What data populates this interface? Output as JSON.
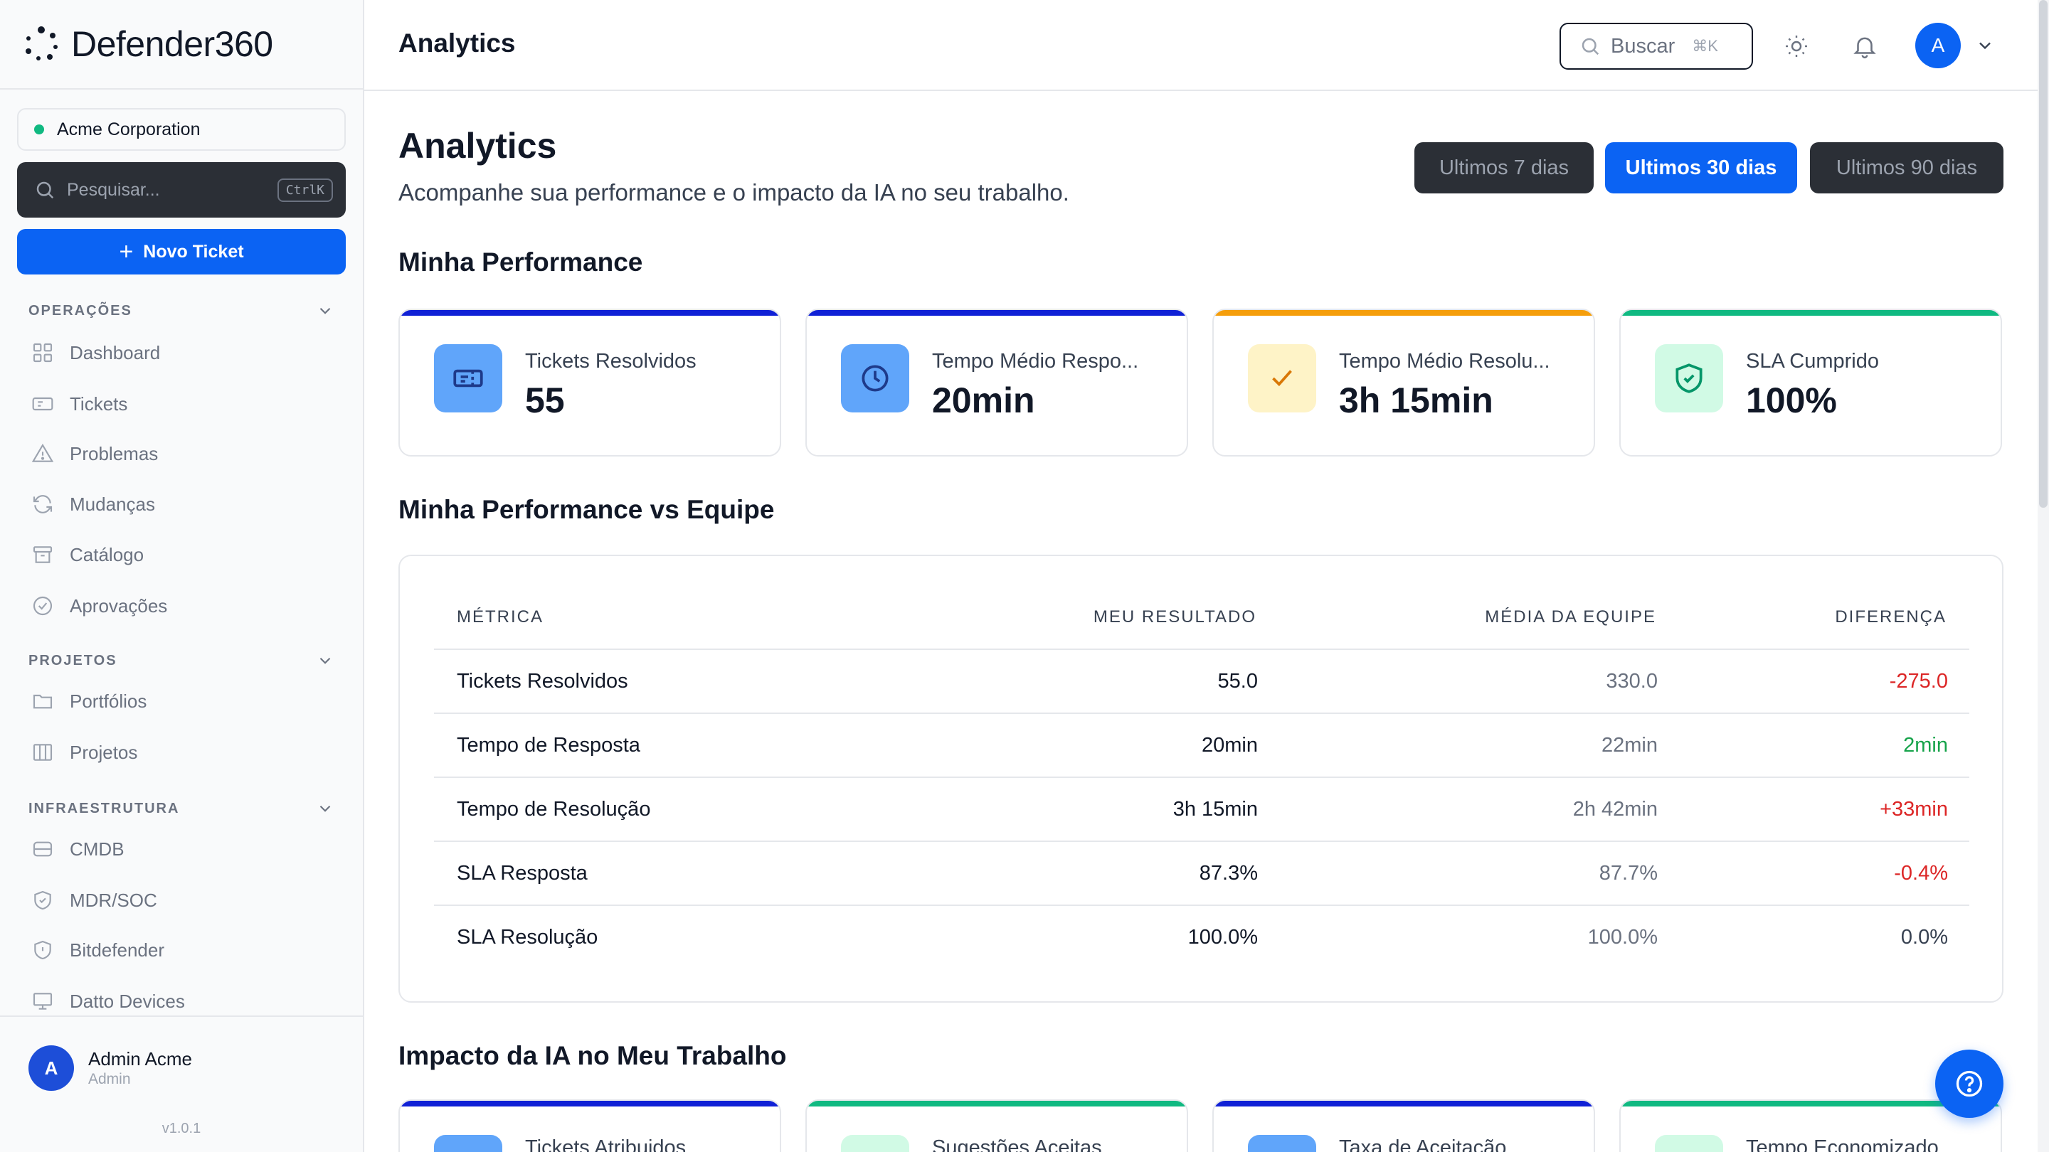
{
  "brand": {
    "name": "Defender360"
  },
  "sidebar": {
    "org": "Acme Corporation",
    "search_placeholder": "Pesquisar...",
    "search_shortcut": "CtrlK",
    "new_ticket": "Novo Ticket",
    "sections": [
      {
        "title": "OPERAÇÕES",
        "items": [
          "Dashboard",
          "Tickets",
          "Problemas",
          "Mudanças",
          "Catálogo",
          "Aprovações"
        ]
      },
      {
        "title": "PROJETOS",
        "items": [
          "Portfólios",
          "Projetos"
        ]
      },
      {
        "title": "INFRAESTRUTURA",
        "items": [
          "CMDB",
          "MDR/SOC",
          "Bitdefender",
          "Datto Devices"
        ]
      }
    ],
    "user": {
      "initial": "A",
      "name": "Admin Acme",
      "role": "Admin"
    },
    "version": "v1.0.1"
  },
  "header": {
    "title": "Analytics",
    "search_placeholder": "Buscar",
    "search_shortcut": "⌘K",
    "avatar_initial": "A"
  },
  "page": {
    "title": "Analytics",
    "subtitle": "Acompanhe sua performance e o impacto da IA no seu trabalho.",
    "periods": [
      "Ultimos 7 dias",
      "Ultimos 30 dias",
      "Ultimos 90 dias"
    ],
    "active_period": "Ultimos 30 dias"
  },
  "performance": {
    "title": "Minha Performance",
    "cards": [
      {
        "label": "Tickets Resolvidos",
        "value": "55",
        "icon": "ticket-icon",
        "accent": "#1021d6"
      },
      {
        "label": "Tempo Médio Respo...",
        "value": "20min",
        "icon": "clock-icon",
        "accent": "#1021d6"
      },
      {
        "label": "Tempo Médio Resolu...",
        "value": "3h 15min",
        "icon": "check-icon",
        "accent": "#f59e0b"
      },
      {
        "label": "SLA Cumprido",
        "value": "100%",
        "icon": "shield-check-icon",
        "accent": "#10b981"
      }
    ]
  },
  "comparison": {
    "title": "Minha Performance vs Equipe",
    "headers": [
      "MÉTRICA",
      "MEU RESULTADO",
      "MÉDIA DA EQUIPE",
      "DIFERENÇA"
    ],
    "rows": [
      {
        "metric": "Tickets Resolvidos",
        "mine": "55.0",
        "team": "330.0",
        "diff": "-275.0",
        "diff_color": "#dc2626"
      },
      {
        "metric": "Tempo de Resposta",
        "mine": "20min",
        "team": "22min",
        "diff": "2min",
        "diff_color": "#16a34a"
      },
      {
        "metric": "Tempo de Resolução",
        "mine": "3h 15min",
        "team": "2h 42min",
        "diff": "+33min",
        "diff_color": "#dc2626"
      },
      {
        "metric": "SLA Resposta",
        "mine": "87.3%",
        "team": "87.7%",
        "diff": "-0.4%",
        "diff_color": "#dc2626"
      },
      {
        "metric": "SLA Resolução",
        "mine": "100.0%",
        "team": "100.0%",
        "diff": "0.0%",
        "diff_color": "#374151"
      }
    ]
  },
  "ai_impact": {
    "title": "Impacto da IA no Meu Trabalho",
    "cards": [
      {
        "label": "Tickets Atribuidos",
        "accent": "#1021d6",
        "icon_bg": "#60a5fa"
      },
      {
        "label": "Sugestões Aceitas",
        "accent": "#10b981",
        "icon_bg": "#d1fae5"
      },
      {
        "label": "Taxa de Aceitação",
        "accent": "#1021d6",
        "icon_bg": "#60a5fa"
      },
      {
        "label": "Tempo Economizado",
        "accent": "#10b981",
        "icon_bg": "#d1fae5"
      }
    ]
  }
}
